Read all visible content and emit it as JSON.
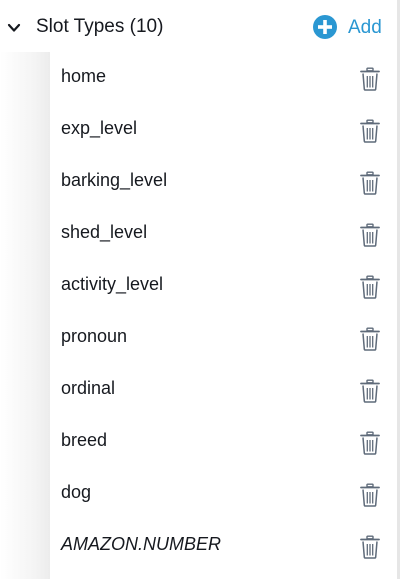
{
  "header": {
    "title": "Slot Types (10)",
    "add_label": "Add",
    "accent_color": "#2a97d2"
  },
  "slot_types": [
    {
      "name": "home",
      "builtin": false
    },
    {
      "name": "exp_level",
      "builtin": false
    },
    {
      "name": "barking_level",
      "builtin": false
    },
    {
      "name": "shed_level",
      "builtin": false
    },
    {
      "name": "activity_level",
      "builtin": false
    },
    {
      "name": "pronoun",
      "builtin": false
    },
    {
      "name": "ordinal",
      "builtin": false
    },
    {
      "name": "breed",
      "builtin": false
    },
    {
      "name": "dog",
      "builtin": false
    },
    {
      "name": "AMAZON.NUMBER",
      "builtin": true
    }
  ],
  "icons": {
    "collapse": "chevron-down-icon",
    "add": "plus-circle-icon",
    "delete": "trash-icon"
  }
}
